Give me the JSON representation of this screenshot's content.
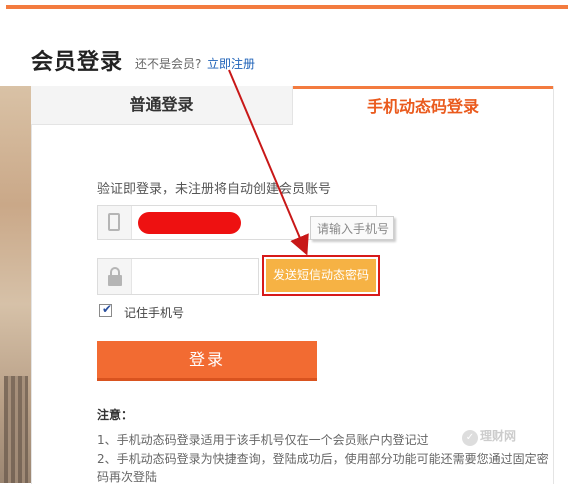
{
  "page": {
    "title": "会员登录",
    "not_member": "还不是会员?",
    "register_link": "立即注册"
  },
  "tabs": {
    "normal_login": "普通登录",
    "sms_login": "手机动态码登录"
  },
  "form": {
    "hint": "验证即登录，未注册将自动创建会员账号",
    "phone_tooltip": "请输入手机号",
    "send_code_button": "发送短信动态密码",
    "remember_checked": true,
    "remember_label": "记住手机号",
    "login_button": "登录"
  },
  "notice": {
    "title": "注意：",
    "line1": "1、手机动态码登录适用于该手机号仅在一个会员账户内登记过",
    "line2": "2、手机动态码登录为快捷查询，登陆成功后，使用部分功能可能还需要您通过固定密码再次登陆"
  },
  "watermark": {
    "text": "理财网"
  },
  "colors": {
    "accent": "#f37b3f",
    "tab_active_text": "#ea5a1d",
    "send_button": "#f6b244",
    "highlight_border": "#d71a1a",
    "login_button": "#f26b32",
    "link": "#1e62b8"
  }
}
